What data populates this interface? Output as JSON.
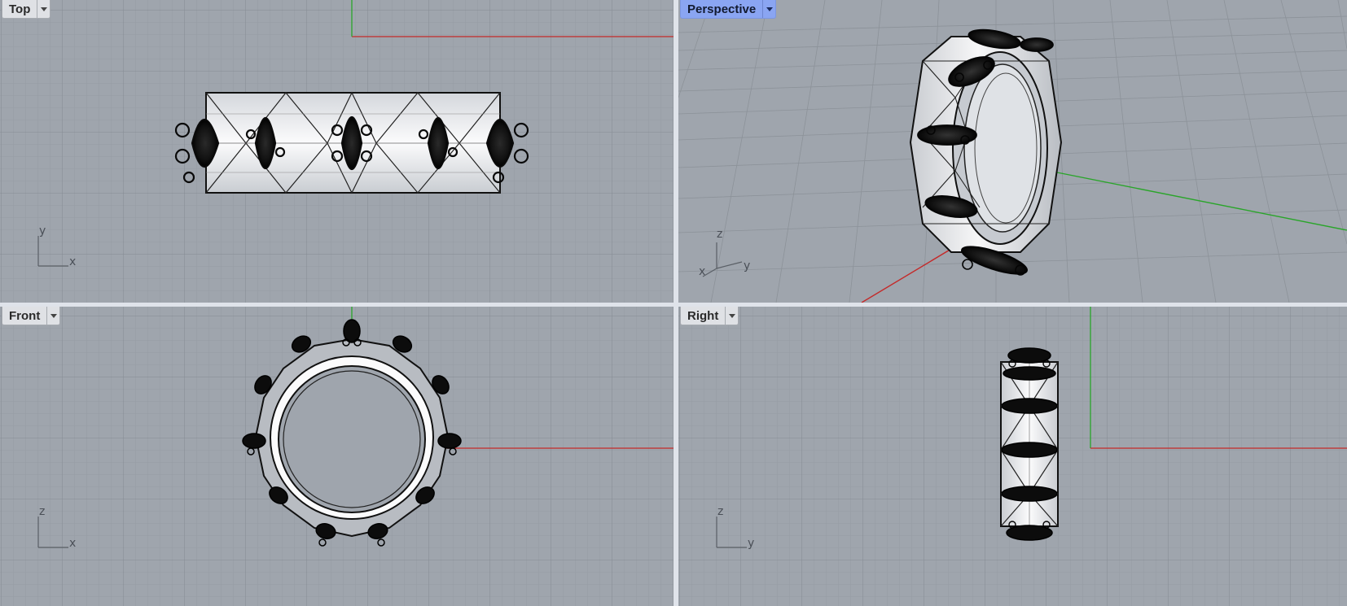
{
  "viewports": {
    "top": {
      "title": "Top",
      "axis_h": "x",
      "axis_v": "y",
      "active": false
    },
    "perspective": {
      "title": "Perspective",
      "axis_h": "y",
      "axis_v": "z",
      "axis_d": "x",
      "active": true
    },
    "front": {
      "title": "Front",
      "axis_h": "x",
      "axis_v": "z",
      "active": false
    },
    "right": {
      "title": "Right",
      "axis_h": "y",
      "axis_v": "z",
      "active": false
    }
  },
  "colors": {
    "viewport_bg": "#9fa5ad",
    "grid_minor": "#959ba3",
    "grid_major": "#848a92",
    "x_axis": "#c42a2a",
    "y_axis": "#2aa52a",
    "active_tab": "#8aa5f2"
  },
  "icons": {
    "viewport_menu": "chevron-down-icon",
    "axis_widget": "world-axes-icon"
  }
}
